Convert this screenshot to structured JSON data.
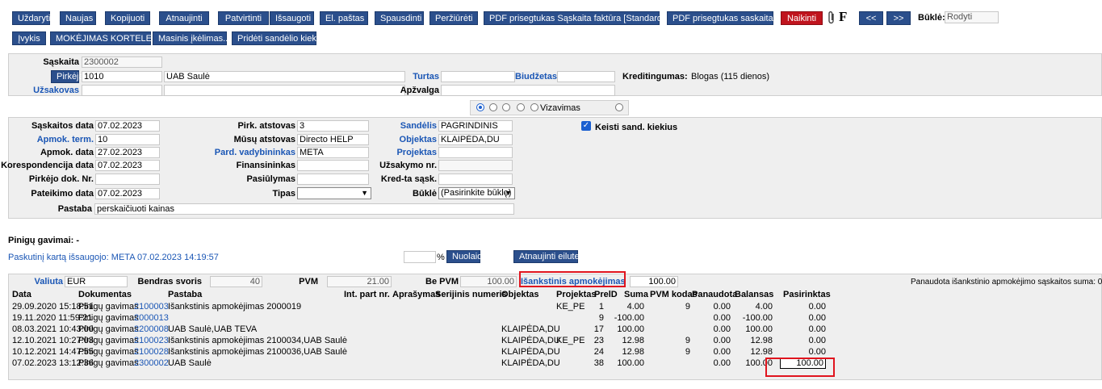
{
  "toolbar": {
    "row1": [
      {
        "name": "close-button",
        "label": "Uždaryti"
      },
      {
        "name": "new-button",
        "label": "Naujas"
      },
      {
        "name": "copy-button",
        "label": "Kopijuoti"
      },
      {
        "name": "refresh-button",
        "label": "Atnaujinti"
      },
      {
        "name": "confirm-button",
        "label": "Patvirtinti"
      },
      {
        "name": "save-button",
        "label": "Išsaugoti"
      },
      {
        "name": "email-button",
        "label": "El. paštas"
      },
      {
        "name": "print-button",
        "label": "Spausdinti"
      },
      {
        "name": "preview-button",
        "label": "Peržiūrėti"
      },
      {
        "name": "pdf-invoice-standard-button",
        "label": "PDF prisegtukas Sąskaita faktūra [Standard]"
      },
      {
        "name": "pdf-invoice-button",
        "label": "PDF prisegtukas saskaita"
      },
      {
        "name": "delete-button",
        "label": "Naikinti"
      }
    ],
    "row2": [
      {
        "name": "events-button",
        "label": "Įvykis"
      },
      {
        "name": "payment-card-button",
        "label": "MOKĖJIMAS KORTELE"
      },
      {
        "name": "mass-entry-button",
        "label": "Masinis įkėlimas..."
      },
      {
        "name": "add-stock-qty-button",
        "label": "Pridėti sandėlio kiekį"
      }
    ],
    "attach_icon": "paperclip-icon",
    "f_label": "F",
    "prev_label": "<<",
    "next_label": ">>",
    "status_label": "Būklė:",
    "status_value": "Rodyti"
  },
  "header": {
    "invoice_label": "Sąskaita",
    "invoice_value": "2300002",
    "buyer_button": "Pirkėjas",
    "buyer_code": "1010",
    "buyer_name": "UAB Saulė",
    "property_label": "Turtas",
    "budget_label": "Biudžetas",
    "credit_label": "Kreditingumas:",
    "credit_value": "Blogas (115 dienos)",
    "orderer_label": "Užsakovas",
    "insurance_label": "Apžvalga",
    "radio_label": "Vizavimas"
  },
  "details": {
    "invoice_date_label": "Sąskaitos data",
    "invoice_date": "07.02.2023",
    "pay_term_label": "Apmok. term.",
    "pay_term": "10",
    "pay_date_label": "Apmok. data",
    "pay_date": "27.02.2023",
    "corr_date_label": "Korespondencija data",
    "corr_date": "07.02.2023",
    "buyer_doc_label": "Pirkėjo dok. Nr.",
    "buyer_doc": "",
    "delivery_date_label": "Pateikimo data",
    "delivery_date": "07.02.2023",
    "buyer_rep_label": "Pirk. atstovas",
    "buyer_rep": "3",
    "our_rep_label": "Mūsų atstovas",
    "our_rep": "Directo HELP",
    "sales_mgr_label": "Pard. vadybininkas",
    "sales_mgr": "META",
    "financier_label": "Finansininkas",
    "financier": "",
    "offer_label": "Pasiūlymas",
    "offer": "",
    "type_label": "Tipas",
    "type_value": "",
    "warehouse_label": "Sandėlis",
    "warehouse": "PAGRINDINIS",
    "object_label": "Objektas",
    "object": "KLAIPĖDA,DU",
    "projects_label": "Projektas",
    "projects": "",
    "order_no_label": "Užsakymo nr.",
    "order_no": "",
    "credit_inv_label": "Kred-ta sąsk.",
    "credit_inv": "",
    "state_label": "Būklė",
    "state_value": "(Pasirinkite būklę)",
    "change_stock_label": "Keisti sand. kiekius",
    "note_label": "Pastaba",
    "note": "perskaičiuoti kainas"
  },
  "receipts_label": "Pinigų gavimai: -",
  "last_saved": "Paskutinį kartą išsaugojo: META 07.02.2023 14:19:57",
  "discount_pct": "%",
  "discount_button": "Nuolaida",
  "refresh_rows_button": "Atnaujinti eilutes",
  "totals": {
    "currency_label": "Valiuta",
    "currency": "EUR",
    "weight_label": "Bendras svoris",
    "weight": "40",
    "vat_label": "PVM",
    "vat": "21.00",
    "net_label": "Be PVM",
    "net": "100.00",
    "prepay_label": "Išankstinis apmokėjimas",
    "prepay": "100.00",
    "used_prepay": "Panaudota išankstinio apmokėjimo sąskaitos suma: 0"
  },
  "table": {
    "headers": [
      "Data",
      "Dokumentas",
      "Pastaba",
      "Int. part nr.",
      "Aprašymas",
      "Serijinis numeris",
      "Objektas",
      "Projektas",
      "PrelD",
      "Suma",
      "PVM kodas",
      "Panaudota",
      "Balansas",
      "Pasirinktas"
    ],
    "rows": [
      {
        "date": "29.09.2020 15:18:51",
        "doc": "Pinigų gavimas",
        "doc_no": "2100003",
        "note": "Išankstinis apmokėjimas 2000019",
        "object": "",
        "project": "KE_PE",
        "preid": "1",
        "sum": "4.00",
        "vat": "9",
        "used": "0.00",
        "balance": "4.00",
        "selected": "0.00"
      },
      {
        "date": "19.11.2020 11:59:21",
        "doc": "Pinigų gavimas",
        "doc_no": "2000013",
        "note": "",
        "object": "",
        "project": "",
        "preid": "9",
        "sum": "-100.00",
        "vat": "",
        "used": "0.00",
        "balance": "-100.00",
        "selected": "0.00"
      },
      {
        "date": "08.03.2021 10:43:00",
        "doc": "Pinigų gavimas",
        "doc_no": "2200008",
        "note": "UAB Saulė,UAB TEVA",
        "object": "KLAIPĖDA,DU",
        "project": "",
        "preid": "17",
        "sum": "100.00",
        "vat": "",
        "used": "0.00",
        "balance": "100.00",
        "selected": "0.00"
      },
      {
        "date": "12.10.2021 10:27:03",
        "doc": "Pinigų gavimas",
        "doc_no": "2100023",
        "note": "Išankstinis apmokėjimas 2100034,UAB Saulė",
        "object": "KLAIPĖDA,DU",
        "project": "KE_PE",
        "preid": "23",
        "sum": "12.98",
        "vat": "9",
        "used": "0.00",
        "balance": "12.98",
        "selected": "0.00"
      },
      {
        "date": "10.12.2021 14:47:55",
        "doc": "Pinigų gavimas",
        "doc_no": "2100028",
        "note": "Išankstinis apmokėjimas 2100036,UAB Saulė",
        "object": "KLAIPĖDA,DU",
        "project": "",
        "preid": "24",
        "sum": "12.98",
        "vat": "9",
        "used": "0.00",
        "balance": "12.98",
        "selected": "0.00"
      },
      {
        "date": "07.02.2023 13:12:36",
        "doc": "Pinigų gavimas",
        "doc_no": "2300002",
        "note": "UAB Saulė",
        "object": "KLAIPĖDA,DU",
        "project": "",
        "preid": "38",
        "sum": "100.00",
        "vat": "",
        "used": "0.00",
        "balance": "100.00",
        "selected": "100.00"
      }
    ]
  }
}
